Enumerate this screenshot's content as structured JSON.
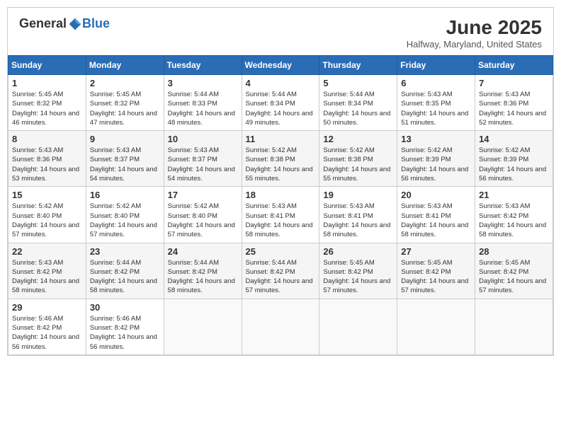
{
  "header": {
    "logo_general": "General",
    "logo_blue": "Blue",
    "month_year": "June 2025",
    "location": "Halfway, Maryland, United States"
  },
  "columns": [
    "Sunday",
    "Monday",
    "Tuesday",
    "Wednesday",
    "Thursday",
    "Friday",
    "Saturday"
  ],
  "weeks": [
    [
      {
        "day": "1",
        "sunrise": "5:45 AM",
        "sunset": "8:32 PM",
        "daylight": "14 hours and 46 minutes."
      },
      {
        "day": "2",
        "sunrise": "5:45 AM",
        "sunset": "8:32 PM",
        "daylight": "14 hours and 47 minutes."
      },
      {
        "day": "3",
        "sunrise": "5:44 AM",
        "sunset": "8:33 PM",
        "daylight": "14 hours and 48 minutes."
      },
      {
        "day": "4",
        "sunrise": "5:44 AM",
        "sunset": "8:34 PM",
        "daylight": "14 hours and 49 minutes."
      },
      {
        "day": "5",
        "sunrise": "5:44 AM",
        "sunset": "8:34 PM",
        "daylight": "14 hours and 50 minutes."
      },
      {
        "day": "6",
        "sunrise": "5:43 AM",
        "sunset": "8:35 PM",
        "daylight": "14 hours and 51 minutes."
      },
      {
        "day": "7",
        "sunrise": "5:43 AM",
        "sunset": "8:36 PM",
        "daylight": "14 hours and 52 minutes."
      }
    ],
    [
      {
        "day": "8",
        "sunrise": "5:43 AM",
        "sunset": "8:36 PM",
        "daylight": "14 hours and 53 minutes."
      },
      {
        "day": "9",
        "sunrise": "5:43 AM",
        "sunset": "8:37 PM",
        "daylight": "14 hours and 54 minutes."
      },
      {
        "day": "10",
        "sunrise": "5:43 AM",
        "sunset": "8:37 PM",
        "daylight": "14 hours and 54 minutes."
      },
      {
        "day": "11",
        "sunrise": "5:42 AM",
        "sunset": "8:38 PM",
        "daylight": "14 hours and 55 minutes."
      },
      {
        "day": "12",
        "sunrise": "5:42 AM",
        "sunset": "8:38 PM",
        "daylight": "14 hours and 55 minutes."
      },
      {
        "day": "13",
        "sunrise": "5:42 AM",
        "sunset": "8:39 PM",
        "daylight": "14 hours and 56 minutes."
      },
      {
        "day": "14",
        "sunrise": "5:42 AM",
        "sunset": "8:39 PM",
        "daylight": "14 hours and 56 minutes."
      }
    ],
    [
      {
        "day": "15",
        "sunrise": "5:42 AM",
        "sunset": "8:40 PM",
        "daylight": "14 hours and 57 minutes."
      },
      {
        "day": "16",
        "sunrise": "5:42 AM",
        "sunset": "8:40 PM",
        "daylight": "14 hours and 57 minutes."
      },
      {
        "day": "17",
        "sunrise": "5:42 AM",
        "sunset": "8:40 PM",
        "daylight": "14 hours and 57 minutes."
      },
      {
        "day": "18",
        "sunrise": "5:43 AM",
        "sunset": "8:41 PM",
        "daylight": "14 hours and 58 minutes."
      },
      {
        "day": "19",
        "sunrise": "5:43 AM",
        "sunset": "8:41 PM",
        "daylight": "14 hours and 58 minutes."
      },
      {
        "day": "20",
        "sunrise": "5:43 AM",
        "sunset": "8:41 PM",
        "daylight": "14 hours and 58 minutes."
      },
      {
        "day": "21",
        "sunrise": "5:43 AM",
        "sunset": "8:42 PM",
        "daylight": "14 hours and 58 minutes."
      }
    ],
    [
      {
        "day": "22",
        "sunrise": "5:43 AM",
        "sunset": "8:42 PM",
        "daylight": "14 hours and 58 minutes."
      },
      {
        "day": "23",
        "sunrise": "5:44 AM",
        "sunset": "8:42 PM",
        "daylight": "14 hours and 58 minutes."
      },
      {
        "day": "24",
        "sunrise": "5:44 AM",
        "sunset": "8:42 PM",
        "daylight": "14 hours and 58 minutes."
      },
      {
        "day": "25",
        "sunrise": "5:44 AM",
        "sunset": "8:42 PM",
        "daylight": "14 hours and 57 minutes."
      },
      {
        "day": "26",
        "sunrise": "5:45 AM",
        "sunset": "8:42 PM",
        "daylight": "14 hours and 57 minutes."
      },
      {
        "day": "27",
        "sunrise": "5:45 AM",
        "sunset": "8:42 PM",
        "daylight": "14 hours and 57 minutes."
      },
      {
        "day": "28",
        "sunrise": "5:45 AM",
        "sunset": "8:42 PM",
        "daylight": "14 hours and 57 minutes."
      }
    ],
    [
      {
        "day": "29",
        "sunrise": "5:46 AM",
        "sunset": "8:42 PM",
        "daylight": "14 hours and 56 minutes."
      },
      {
        "day": "30",
        "sunrise": "5:46 AM",
        "sunset": "8:42 PM",
        "daylight": "14 hours and 56 minutes."
      },
      null,
      null,
      null,
      null,
      null
    ]
  ]
}
